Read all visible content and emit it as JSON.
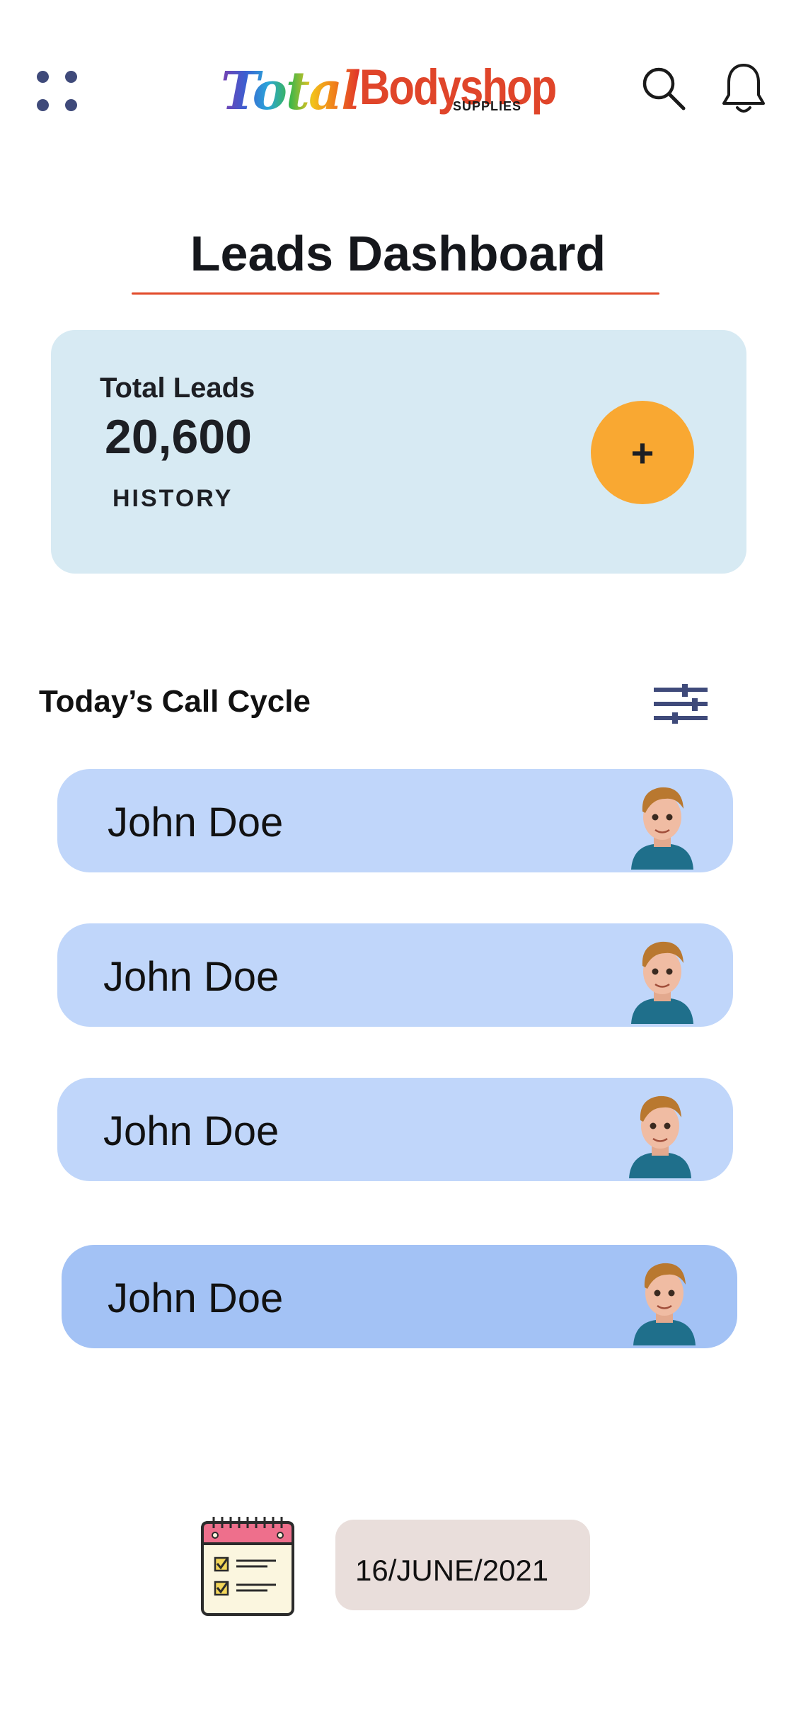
{
  "header": {
    "logo": {
      "word1": "Total",
      "word2": "Bodyshop",
      "word3": "SUPPLIES"
    },
    "icons": [
      "menu-dots-icon",
      "search-icon",
      "bell-icon"
    ]
  },
  "page": {
    "title": "Leads Dashboard"
  },
  "leads_card": {
    "label": "Total Leads",
    "value": "20,600",
    "history_label": "HISTORY",
    "add_label": "+"
  },
  "call_cycle": {
    "title": "Today’s Call Cycle",
    "contacts": [
      {
        "name": "John Doe"
      },
      {
        "name": "John Doe"
      },
      {
        "name": "John Doe"
      },
      {
        "name": "John Doe"
      }
    ]
  },
  "footer": {
    "date": "16/JUNE/2021"
  },
  "colors": {
    "accent_underline": "#e24a2a",
    "leads_card_bg": "#d7eaf3",
    "add_button": "#f9a832",
    "contact_card": "#c0d6fa",
    "contact_card_active": "#a3c2f5",
    "date_box": "#e9dedb",
    "icon_navy": "#3f4a7a"
  }
}
